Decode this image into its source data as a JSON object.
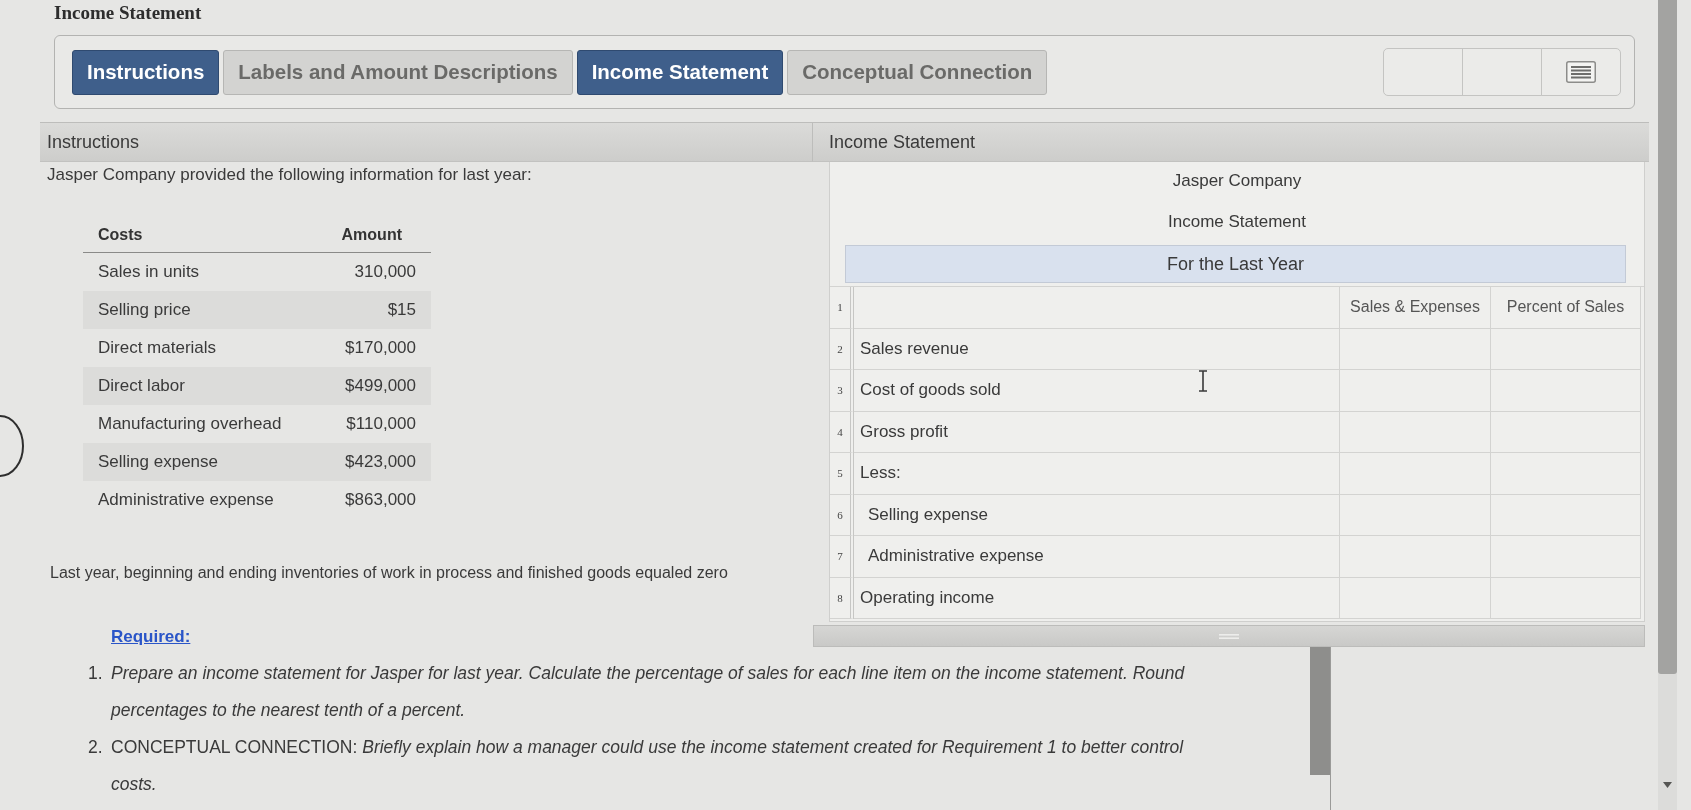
{
  "page_title": "Income Statement",
  "tabs": [
    {
      "label": "Instructions",
      "selected": true
    },
    {
      "label": "Labels and Amount Descriptions",
      "selected": false
    },
    {
      "label": "Income Statement",
      "selected": true
    },
    {
      "label": "Conceptual Connection",
      "selected": false
    }
  ],
  "instructions_panel": {
    "header": "Instructions",
    "intro": "Jasper Company provided the following information for last year:",
    "cost_table": {
      "columns": [
        "Costs",
        "Amount"
      ],
      "rows": [
        [
          "Sales in units",
          "310,000"
        ],
        [
          "Selling price",
          "$15"
        ],
        [
          "Direct materials",
          "$170,000"
        ],
        [
          "Direct labor",
          "$499,000"
        ],
        [
          "Manufacturing overhead",
          "$110,000"
        ],
        [
          "Selling expense",
          "$423,000"
        ],
        [
          "Administrative expense",
          "$863,000"
        ]
      ]
    },
    "note": "Last year, beginning and ending inventories of work in process and finished goods equaled zero",
    "required_label": "Required:",
    "requirements": [
      {
        "number": "1.",
        "text": "Prepare an income statement for Jasper for last year. Calculate the percentage of sales for each line item on the income statement. Round percentages to the nearest tenth of a percent."
      },
      {
        "number": "2.",
        "lead": "CONCEPTUAL CONNECTION:",
        "text": "Briefly explain how a manager could use the income statement created for Requirement 1 to better control costs."
      }
    ]
  },
  "income_statement_panel": {
    "header": "Income Statement",
    "company": "Jasper Company",
    "statement_title": "Income Statement",
    "period": "For the Last Year",
    "header_row": {
      "number": "1",
      "columns": [
        "Sales & Expenses",
        "Percent of Sales"
      ]
    },
    "rows": [
      {
        "number": "2",
        "label": "Sales revenue"
      },
      {
        "number": "3",
        "label": "Cost of goods sold"
      },
      {
        "number": "4",
        "label": "Gross profit"
      },
      {
        "number": "5",
        "label": "Less:",
        "children": [
          {
            "number": "6",
            "label": "Selling expense"
          },
          {
            "number": "7",
            "label": "Administrative expense"
          }
        ]
      },
      {
        "number": "8",
        "label": "Operating income"
      }
    ]
  }
}
